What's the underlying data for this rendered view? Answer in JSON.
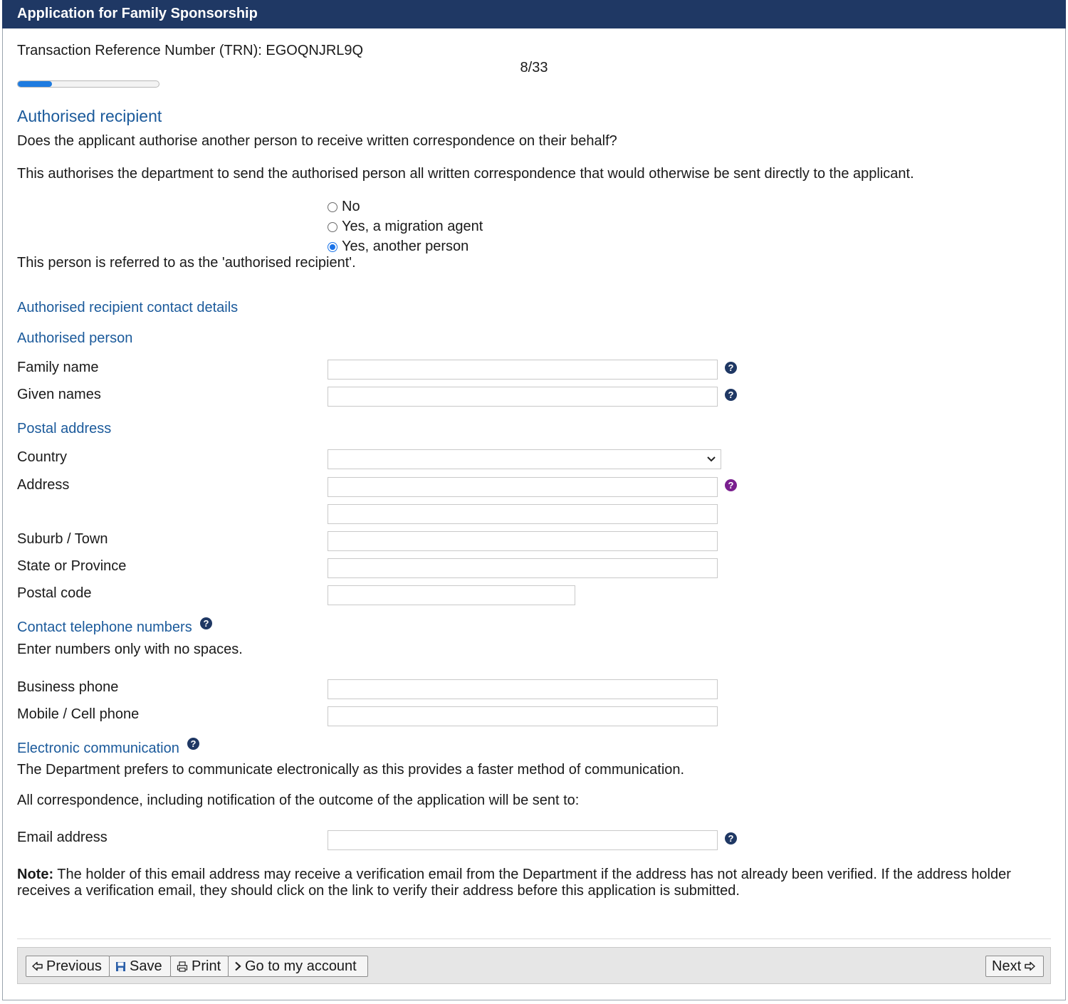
{
  "window": {
    "title": "Application for Family Sponsorship"
  },
  "trn": {
    "label": "Transaction Reference Number (TRN):",
    "value": "EGOQNJRL9Q"
  },
  "progress": {
    "text": "8/33",
    "current": 8,
    "total": 33,
    "fraction": 0.242
  },
  "section": {
    "title": "Authorised recipient",
    "question": "Does the applicant authorise another person to receive written correspondence on their behalf?",
    "explanation": "This authorises the department to send the authorised person all written correspondence that would otherwise be sent directly to the applicant.",
    "options": [
      {
        "label": "No",
        "checked": false
      },
      {
        "label": "Yes, a migration agent",
        "checked": false
      },
      {
        "label": "Yes, another person",
        "checked": true
      }
    ],
    "referred_note": "This person is referred to as the 'authorised recipient'."
  },
  "contact": {
    "heading": "Authorised recipient contact details",
    "person_heading": "Authorised person",
    "family_name_label": "Family name",
    "given_names_label": "Given names",
    "family_name_value": "",
    "given_names_value": ""
  },
  "postal": {
    "heading": "Postal address",
    "country_label": "Country",
    "country_value": "",
    "address_label": "Address",
    "suburb_label": "Suburb / Town",
    "state_label": "State or Province",
    "postcode_label": "Postal code"
  },
  "phones": {
    "heading": "Contact telephone numbers",
    "hint": "Enter numbers only with no spaces.",
    "business_label": "Business phone",
    "mobile_label": "Mobile / Cell phone"
  },
  "electronic": {
    "heading": "Electronic communication",
    "text1": "The Department prefers to communicate electronically as this provides a faster method of communication.",
    "text2": "All correspondence, including notification of the outcome of the application will be sent to:",
    "email_label": "Email address",
    "note_label": "Note:",
    "note_text": " The holder of this email address may receive a verification email from the Department if the address has not already been verified. If the address holder receives a verification email, they should click on the link to verify their address before this application is submitted."
  },
  "footer": {
    "previous": "Previous",
    "save": "Save",
    "print": "Print",
    "account": "Go to my account",
    "next": "Next"
  },
  "icons": {
    "help": "question-circle-icon",
    "previous": "arrow-left-icon",
    "save": "floppy-disk-icon",
    "print": "printer-icon",
    "account": "chevron-right-icon",
    "next": "arrow-right-icon"
  },
  "colors": {
    "titlebar": "#1f3864",
    "heading": "#1b5a9b",
    "progress": "#1e7be0",
    "help_alt": "#7a1f8f"
  }
}
